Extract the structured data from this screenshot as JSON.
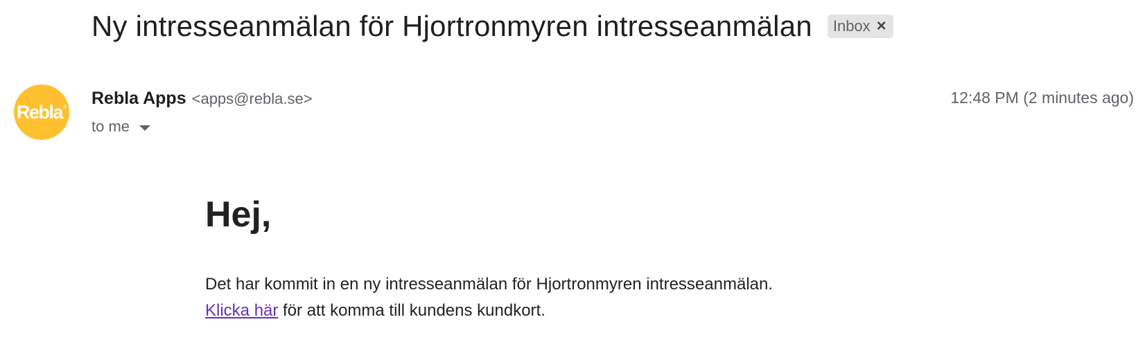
{
  "email": {
    "subject": "Ny intresseanmälan för Hjortronmyren intresseanmälan",
    "label": {
      "text": "Inbox",
      "remove_symbol": "×"
    },
    "sender": {
      "avatar_text": "Rebla",
      "avatar_mark": "®",
      "avatar_color": "#fec02f",
      "name": "Rebla Apps",
      "email": "<apps@rebla.se>"
    },
    "timestamp": "12:48 PM (2 minutes ago)",
    "recipient": "to me",
    "body": {
      "greeting": "Hej,",
      "line1": "Det har kommit in en ny intresseanmälan för Hjortronmyren intresseanmälan.",
      "link_text": "Klicka här",
      "link_color": "#6a2fb3",
      "line2_rest": " för att komma till kundens kundkort."
    }
  }
}
